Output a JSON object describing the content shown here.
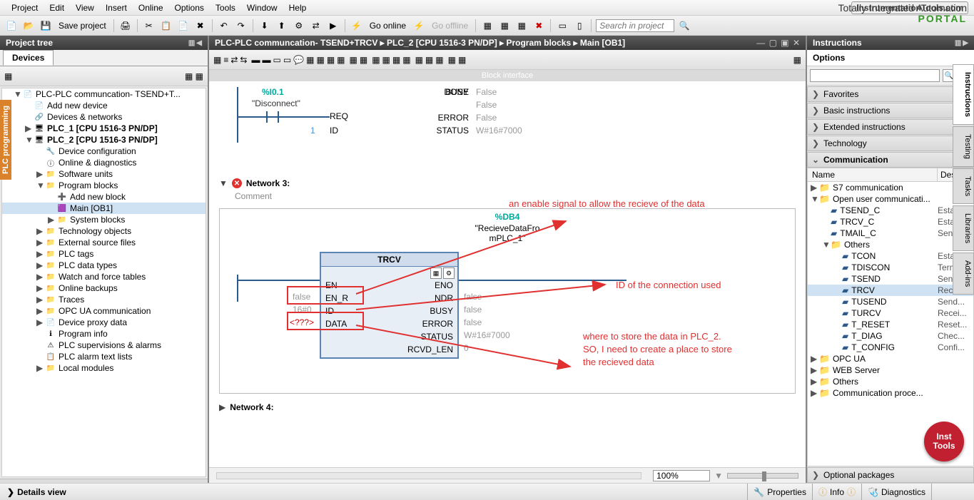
{
  "menu": [
    "Project",
    "Edit",
    "View",
    "Insert",
    "Online",
    "Options",
    "Tools",
    "Window",
    "Help"
  ],
  "brand_watermark": "InstrumentationTools.com",
  "tia": {
    "line1": "Totally Integrated Automation",
    "line2": "PORTAL"
  },
  "toolbar_save": "Save project",
  "toolbar_go_online": "Go online",
  "toolbar_go_offline": "Go offline",
  "toolbar_search_placeholder": "Search in project",
  "left": {
    "title": "Project tree",
    "tab": "Devices",
    "side_tab": "PLC programming",
    "nodes": [
      {
        "d": 1,
        "a": "▼",
        "i": "📄",
        "t": "PLC-PLC communcation- TSEND+T..."
      },
      {
        "d": 2,
        "a": "",
        "i": "📄",
        "t": "Add new device"
      },
      {
        "d": 2,
        "a": "",
        "i": "🔗",
        "t": "Devices & networks"
      },
      {
        "d": 2,
        "a": "▶",
        "i": "🖥",
        "t": "PLC_1 [CPU 1516-3 PN/DP]",
        "bold": true
      },
      {
        "d": 2,
        "a": "▼",
        "i": "🖥",
        "t": "PLC_2 [CPU 1516-3 PN/DP]",
        "bold": true
      },
      {
        "d": 3,
        "a": "",
        "i": "🔧",
        "t": "Device configuration"
      },
      {
        "d": 3,
        "a": "",
        "i": "ⓘ",
        "t": "Online & diagnostics"
      },
      {
        "d": 3,
        "a": "▶",
        "i": "📁",
        "t": "Software units"
      },
      {
        "d": 3,
        "a": "▼",
        "i": "📁",
        "t": "Program blocks"
      },
      {
        "d": 4,
        "a": "",
        "i": "➕",
        "t": "Add new block"
      },
      {
        "d": 4,
        "a": "",
        "i": "🟪",
        "t": "Main [OB1]",
        "sel": true
      },
      {
        "d": 4,
        "a": "▶",
        "i": "📁",
        "t": "System blocks"
      },
      {
        "d": 3,
        "a": "▶",
        "i": "📁",
        "t": "Technology objects"
      },
      {
        "d": 3,
        "a": "▶",
        "i": "📁",
        "t": "External source files"
      },
      {
        "d": 3,
        "a": "▶",
        "i": "📁",
        "t": "PLC tags"
      },
      {
        "d": 3,
        "a": "▶",
        "i": "📁",
        "t": "PLC data types"
      },
      {
        "d": 3,
        "a": "▶",
        "i": "📁",
        "t": "Watch and force tables"
      },
      {
        "d": 3,
        "a": "▶",
        "i": "📁",
        "t": "Online backups"
      },
      {
        "d": 3,
        "a": "▶",
        "i": "📁",
        "t": "Traces"
      },
      {
        "d": 3,
        "a": "▶",
        "i": "📁",
        "t": "OPC UA communication"
      },
      {
        "d": 3,
        "a": "▶",
        "i": "📄",
        "t": "Device proxy data"
      },
      {
        "d": 3,
        "a": "",
        "i": "ℹ",
        "t": "Program info"
      },
      {
        "d": 3,
        "a": "",
        "i": "⚠",
        "t": "PLC supervisions & alarms"
      },
      {
        "d": 3,
        "a": "",
        "i": "📋",
        "t": "PLC alarm text lists"
      },
      {
        "d": 3,
        "a": "▶",
        "i": "📁",
        "t": "Local modules"
      }
    ],
    "details_view": "Details view"
  },
  "center": {
    "breadcrumb": "PLC-PLC communcation- TSEND+TRCV  ▸  PLC_2 [CPU 1516-3 PN/DP]  ▸  Program blocks  ▸  Main [OB1]",
    "block_interface": "Block interface",
    "net2": {
      "io_tag": "%I0.1",
      "io_name": "\"Disconnect\"",
      "req": "REQ",
      "id": "ID",
      "id_val": "1",
      "done": "DONE",
      "done_val": "False",
      "busy": "BUSY",
      "busy_val": "False",
      "error": "ERROR",
      "error_val": "False",
      "status": "STATUS",
      "status_val": "W#16#7000"
    },
    "net3": {
      "title": "Network 3:",
      "comment": "Comment",
      "db": "%DB4",
      "dbname1": "\"RecieveDataFro",
      "dbname2": "mPLC_1\"",
      "fbtype": "TRCV",
      "pins_left": {
        "EN": "EN",
        "EN_R": "EN_R",
        "ID": "ID",
        "DATA": "DATA"
      },
      "pins_right": {
        "ENO": "ENO",
        "NDR": "NDR",
        "BUSY": "BUSY",
        "ERROR": "ERROR",
        "STATUS": "STATUS",
        "RCVD_LEN": "RCVD_LEN"
      },
      "vals_left": {
        "EN_R": "false",
        "ID": "16#0",
        "DATA": "<???>"
      },
      "vals_right": {
        "NDR": "false",
        "BUSY": "false",
        "ERROR": "false",
        "STATUS": "W#16#7000",
        "RCVD_LEN": "0"
      }
    },
    "annotations": {
      "a1": "an enable signal to allow the recieve of the data",
      "a2": "ID of the connection used",
      "a3_l1": "where to store the data in PLC_2.",
      "a3_l2": "SO, I need to create a place to store",
      "a3_l3": "the recieved data"
    },
    "net4": "Network 4:",
    "zoom": "100%"
  },
  "bottom_tabs": {
    "properties": "Properties",
    "info": "Info",
    "diagnostics": "Diagnostics"
  },
  "right": {
    "title": "Instructions",
    "options": "Options",
    "accordions": [
      "Favorites",
      "Basic instructions",
      "Extended instructions",
      "Technology",
      "Communication"
    ],
    "table_head": {
      "name": "Name",
      "desc": "Desc..."
    },
    "rows": [
      {
        "d": 0,
        "a": "▶",
        "i": "📁",
        "t": "S7 communication",
        "dsc": ""
      },
      {
        "d": 0,
        "a": "▼",
        "i": "📁",
        "t": "Open user communicati...",
        "dsc": ""
      },
      {
        "d": 1,
        "a": "",
        "i": "▰",
        "t": "TSEND_C",
        "dsc": "Estab..."
      },
      {
        "d": 1,
        "a": "",
        "i": "▰",
        "t": "TRCV_C",
        "dsc": "Estab..."
      },
      {
        "d": 1,
        "a": "",
        "i": "▰",
        "t": "TMAIL_C",
        "dsc": "Send..."
      },
      {
        "d": 1,
        "a": "▼",
        "i": "📁",
        "t": "Others",
        "dsc": ""
      },
      {
        "d": 2,
        "a": "",
        "i": "▰",
        "t": "TCON",
        "dsc": "Estab..."
      },
      {
        "d": 2,
        "a": "",
        "i": "▰",
        "t": "TDISCON",
        "dsc": "Term..."
      },
      {
        "d": 2,
        "a": "",
        "i": "▰",
        "t": "TSEND",
        "dsc": "Send..."
      },
      {
        "d": 2,
        "a": "",
        "i": "▰",
        "t": "TRCV",
        "dsc": "Recei...",
        "sel": true
      },
      {
        "d": 2,
        "a": "",
        "i": "▰",
        "t": "TUSEND",
        "dsc": "Send..."
      },
      {
        "d": 2,
        "a": "",
        "i": "▰",
        "t": "TURCV",
        "dsc": "Recei..."
      },
      {
        "d": 2,
        "a": "",
        "i": "▰",
        "t": "T_RESET",
        "dsc": "Reset..."
      },
      {
        "d": 2,
        "a": "",
        "i": "▰",
        "t": "T_DIAG",
        "dsc": "Chec..."
      },
      {
        "d": 2,
        "a": "",
        "i": "▰",
        "t": "T_CONFIG",
        "dsc": "Confi..."
      },
      {
        "d": 0,
        "a": "▶",
        "i": "📁",
        "t": "OPC UA",
        "dsc": ""
      },
      {
        "d": 0,
        "a": "▶",
        "i": "📁",
        "t": "WEB Server",
        "dsc": ""
      },
      {
        "d": 0,
        "a": "▶",
        "i": "📁",
        "t": "Others",
        "dsc": ""
      },
      {
        "d": 0,
        "a": "▶",
        "i": "📁",
        "t": "Communication proce...",
        "dsc": ""
      }
    ],
    "optional_pkg": "Optional packages",
    "side_tabs": [
      "Instructions",
      "Testing",
      "Tasks",
      "Libraries",
      "Add-ins"
    ]
  },
  "badge": {
    "l1": "Inst",
    "l2": "Tools"
  }
}
